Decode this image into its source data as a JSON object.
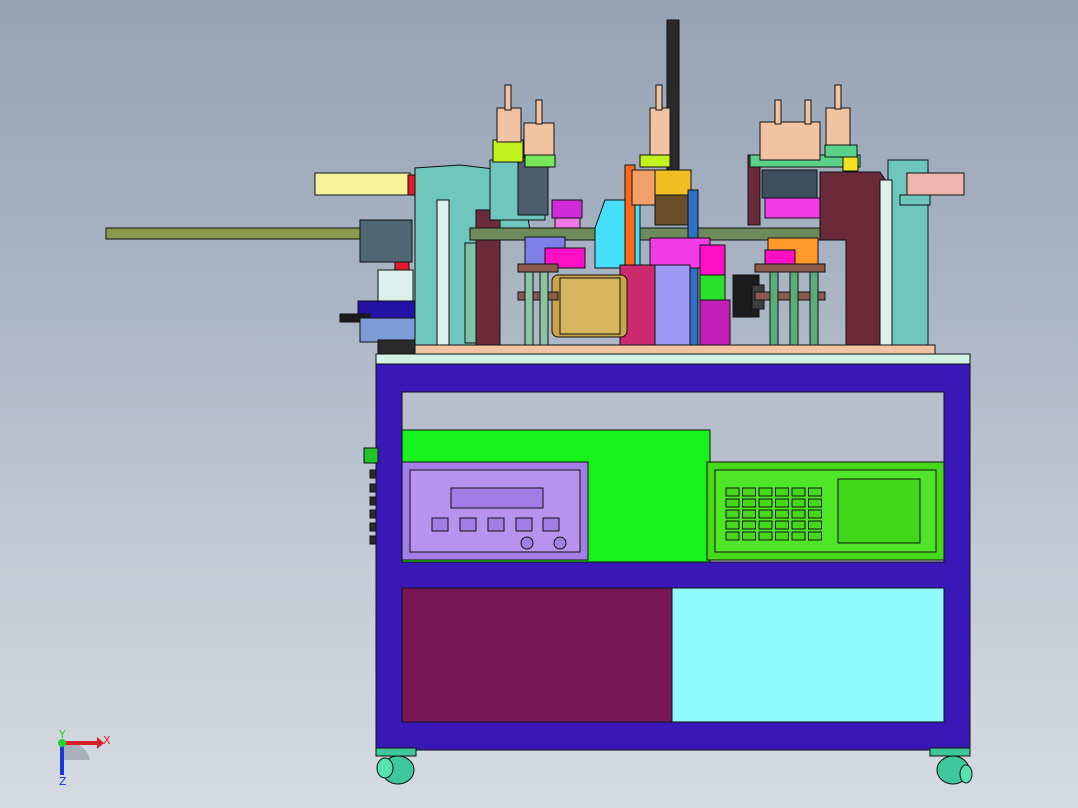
{
  "viewport": {
    "background": [
      "#95a3b5",
      "#d6dbe2"
    ],
    "colors": {
      "frame": "#3a18b8",
      "top_plate": "#d2f2e4",
      "green_panel": "#17f21a",
      "controller": "#a37ee6",
      "plc_panel": "#46d81b",
      "door_left": "#781656",
      "door_right": "#90fbfc",
      "caster": "#3ec79a"
    }
  },
  "triad": {
    "x_label": "X",
    "y_label": "Y",
    "z_label": "Z",
    "icon": "view-orientation-triad-icon"
  }
}
